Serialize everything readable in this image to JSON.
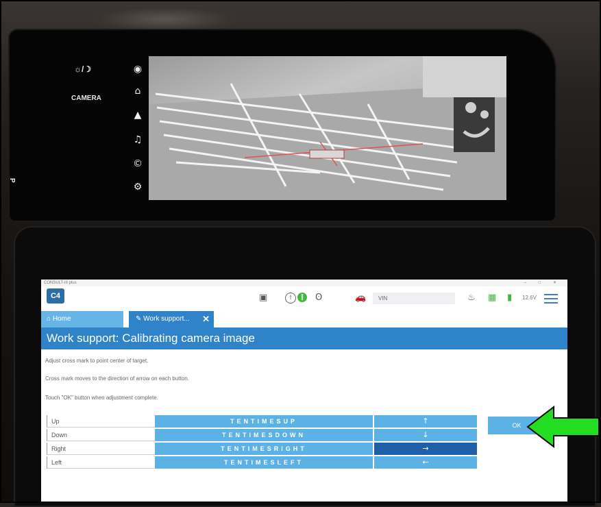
{
  "head_unit": {
    "brightness_label": "☼/☽",
    "mode_label": "CAMERA",
    "edge_label": "P",
    "side_icons": [
      "camera-icon",
      "home-icon",
      "navigation-icon",
      "music-icon",
      "phone-icon",
      "settings-icon"
    ]
  },
  "window": {
    "title": "CONSULT-III plus"
  },
  "toolbar": {
    "logo": "C4",
    "vin_text": "VIN",
    "voltage": "12.6V"
  },
  "tabs": {
    "home_label": "Home",
    "work_label": "Work support...",
    "close_symbol": "✕"
  },
  "page": {
    "title": "Work support: Calibrating camera image",
    "instructions": [
      "Adjust cross mark to point center of target.",
      "Cross mark moves to the direction of arrow on each button.",
      "Touch \"OK\" button when adjustment complete."
    ]
  },
  "controls": [
    {
      "label": "Up",
      "ten_label": "TENTIMESUP",
      "arrow": "↑",
      "active": false
    },
    {
      "label": "Down",
      "ten_label": "TENTIMESDOWN",
      "arrow": "↓",
      "active": false
    },
    {
      "label": "Right",
      "ten_label": "TENTIMESRIGHT",
      "arrow": "→",
      "active": true
    },
    {
      "label": "Left",
      "ten_label": "TENTIMESLEFT",
      "arrow": "←",
      "active": false
    }
  ],
  "ok_label": "OK",
  "colors": {
    "accent": "#2f83c8",
    "button": "#5db2e5",
    "active_button": "#1f5fa8",
    "pointer_arrow": "#22dd22"
  }
}
